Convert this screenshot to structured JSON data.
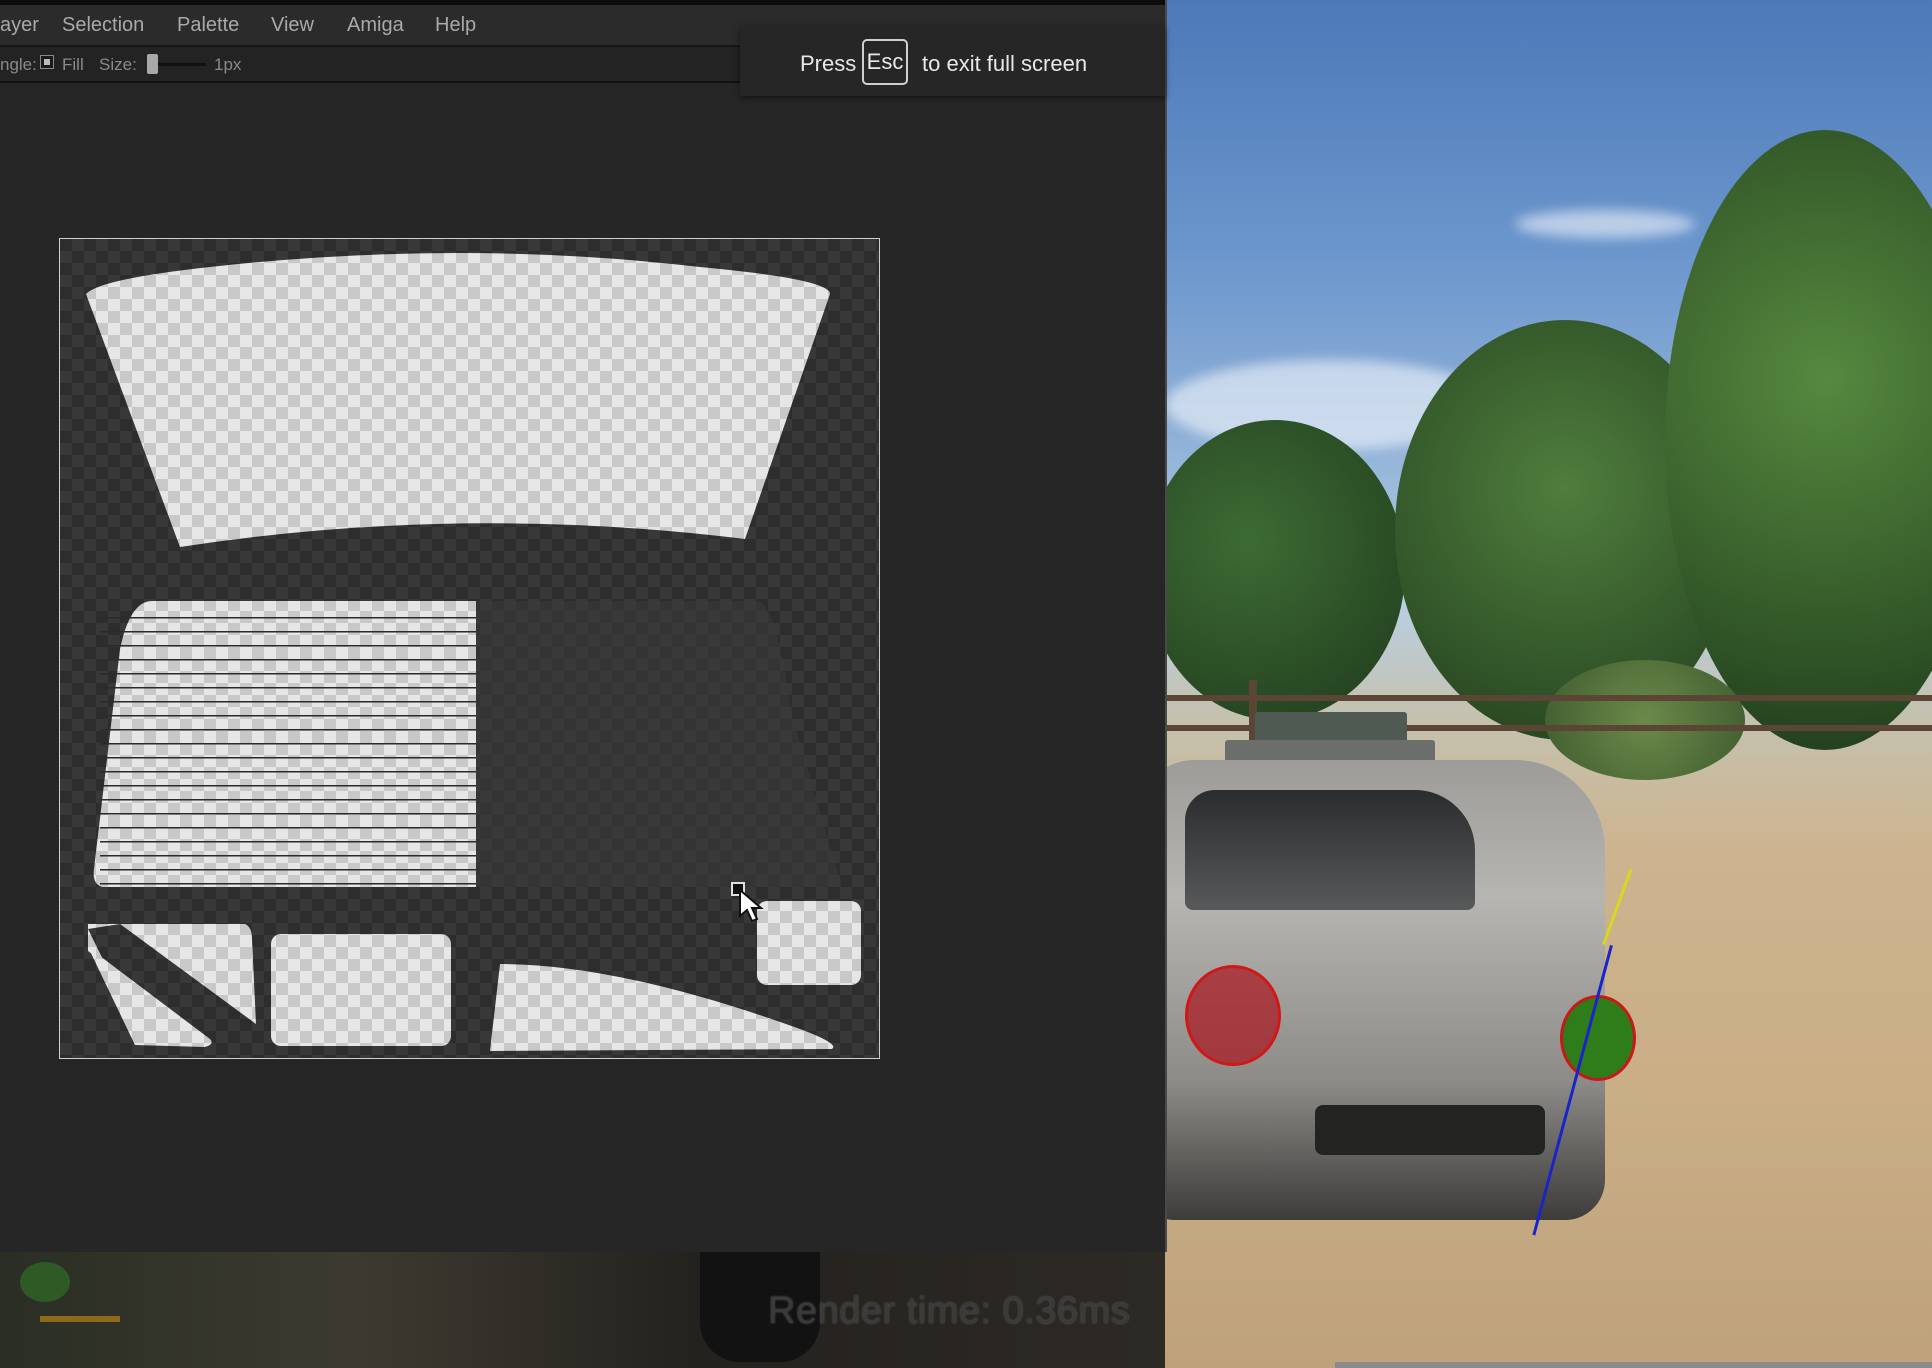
{
  "menubar": {
    "items": [
      "ayer",
      "Selection",
      "Palette",
      "View",
      "Amiga",
      "Help"
    ]
  },
  "toolbar": {
    "angle_label": "ngle:",
    "fill_label": "Fill",
    "size_label": "Size:",
    "size_value": "1px",
    "fill_checked": true
  },
  "fullscreen_toast": {
    "press": "Press",
    "key": "Esc",
    "rest": "to exit full screen"
  },
  "overlay": {
    "render_time": "Render time: 0.36ms"
  },
  "canvas": {
    "checker_light": "#e6e6e6",
    "checker_dark": "#c8c8c8",
    "background": "#2d2d2d"
  },
  "icons": {
    "cursor": "arrow-cursor-icon",
    "checkbox": "checkbox-icon"
  }
}
